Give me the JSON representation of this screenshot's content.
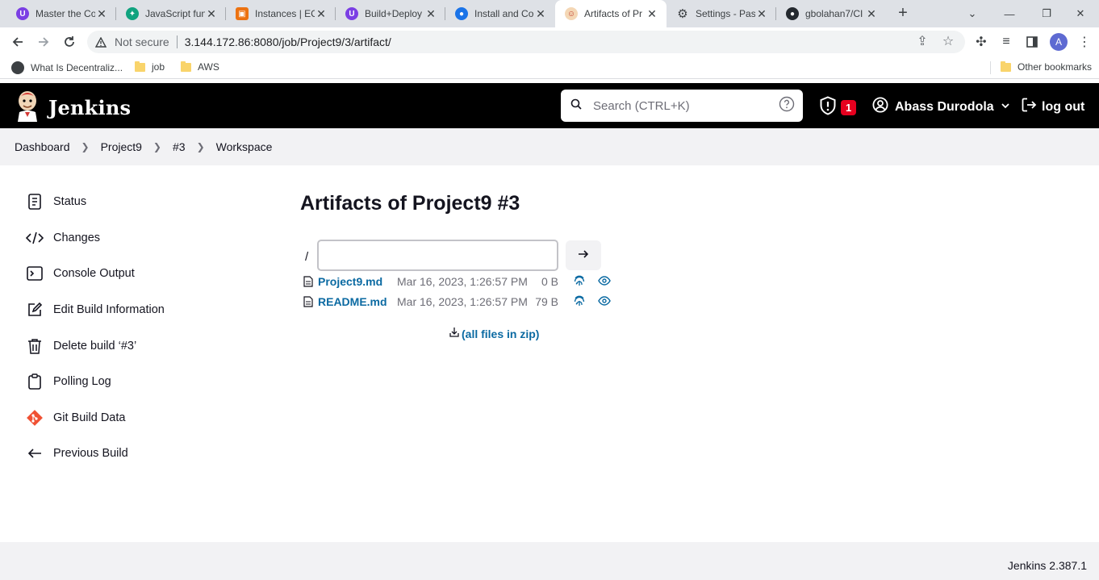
{
  "browser": {
    "tabs": [
      {
        "title": "Master the Co",
        "favicon_color": "#7b3fe4"
      },
      {
        "title": "JavaScript fun",
        "favicon_color": "#10a37f"
      },
      {
        "title": "Instances | EC",
        "favicon_color": "#ec7211"
      },
      {
        "title": "Build+Deploy",
        "favicon_color": "#7b3fe4"
      },
      {
        "title": "Install and Co",
        "favicon_color": "#1a73e8"
      },
      {
        "title": "Artifacts of Pr",
        "favicon_color": "#c0392b",
        "active": true
      },
      {
        "title": "Settings - Pas",
        "favicon_color": "#3c4043"
      },
      {
        "title": "gbolahan7/CI",
        "favicon_color": "#24292f"
      }
    ],
    "security_label": "Not secure",
    "url": "3.144.172.86:8080/job/Project9/3/artifact/",
    "profile_initial": "A",
    "bookmarks": [
      {
        "label": "What Is Decentraliz...",
        "icon": "site-icon"
      },
      {
        "label": "job",
        "icon": "folder-icon"
      },
      {
        "label": "AWS",
        "icon": "folder-icon"
      }
    ],
    "other_bookmarks": "Other bookmarks"
  },
  "header": {
    "brand": "Jenkins",
    "search_placeholder": "Search (CTRL+K)",
    "security_count": "1",
    "user_name": "Abass Durodola",
    "logout": "log out"
  },
  "breadcrumbs": [
    "Dashboard",
    "Project9",
    "#3",
    "Workspace"
  ],
  "sidebar": [
    {
      "label": "Status",
      "icon": "document-icon"
    },
    {
      "label": "Changes",
      "icon": "code-icon"
    },
    {
      "label": "Console Output",
      "icon": "terminal-icon"
    },
    {
      "label": "Edit Build Information",
      "icon": "edit-icon"
    },
    {
      "label": "Delete build ‘#3’",
      "icon": "trash-icon"
    },
    {
      "label": "Polling Log",
      "icon": "clipboard-icon"
    },
    {
      "label": "Git Build Data",
      "icon": "git-icon"
    },
    {
      "label": "Previous Build",
      "icon": "arrow-left-icon"
    }
  ],
  "main": {
    "title": "Artifacts of Project9 #3",
    "path_root": "/",
    "path_value": "",
    "files": [
      {
        "name": "Project9.md",
        "date": "Mar 16, 2023, 1:26:57 PM",
        "size": "0 B"
      },
      {
        "name": "README.md",
        "date": "Mar 16, 2023, 1:26:57 PM",
        "size": "79 B"
      }
    ],
    "zip_label": "(all files in zip)"
  },
  "footer": {
    "version": "Jenkins 2.387.1"
  },
  "colors": {
    "link": "#0b6aa2",
    "header_bg": "#000000",
    "badge": "#e6001f"
  }
}
